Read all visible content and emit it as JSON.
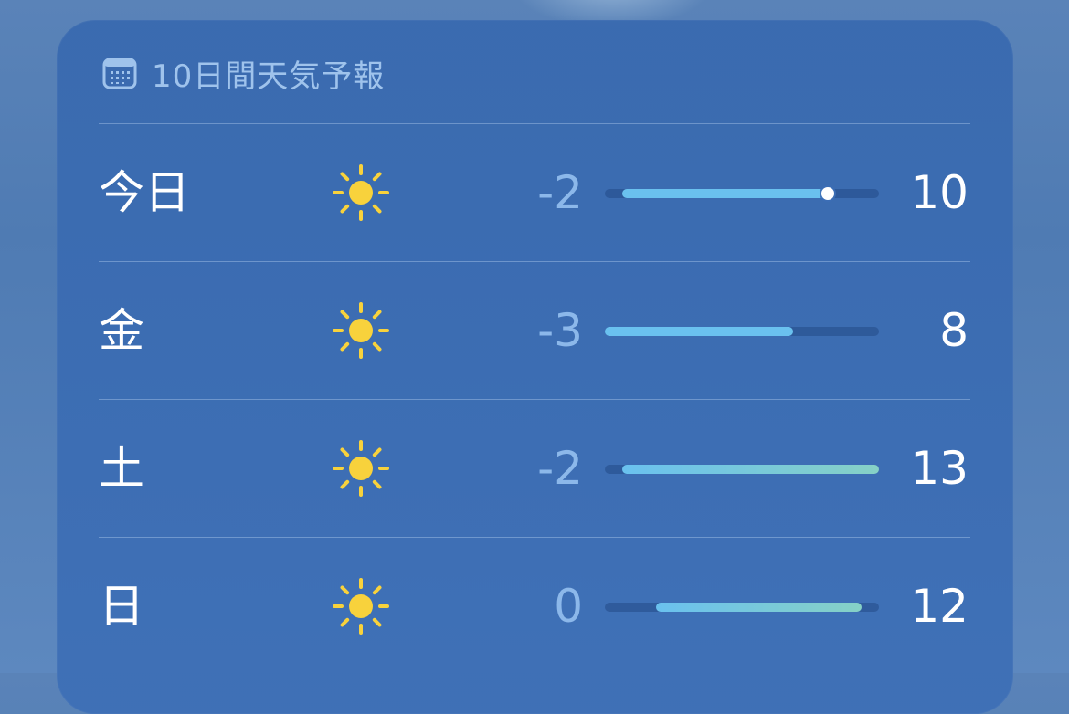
{
  "header": {
    "icon": "calendar-icon",
    "title": "10日間天気予報"
  },
  "colors": {
    "sun": "#f8d23c",
    "bar_cool": "#6ac1ef",
    "bar_warm": "#86d1c6",
    "low_text": "#8cb8ea"
  },
  "scale": {
    "min": -3,
    "max": 13
  },
  "current_temp": 10,
  "days": [
    {
      "label": "今日",
      "icon": "sun-icon",
      "low": "-2",
      "high": "10",
      "low_val": -2,
      "high_val": 10,
      "current": true
    },
    {
      "label": "金",
      "icon": "sun-icon",
      "low": "-3",
      "high": "8",
      "low_val": -3,
      "high_val": 8,
      "current": false
    },
    {
      "label": "土",
      "icon": "sun-icon",
      "low": "-2",
      "high": "13",
      "low_val": -2,
      "high_val": 13,
      "current": false
    },
    {
      "label": "日",
      "icon": "sun-icon",
      "low": "0",
      "high": "12",
      "low_val": 0,
      "high_val": 12,
      "current": false
    }
  ]
}
